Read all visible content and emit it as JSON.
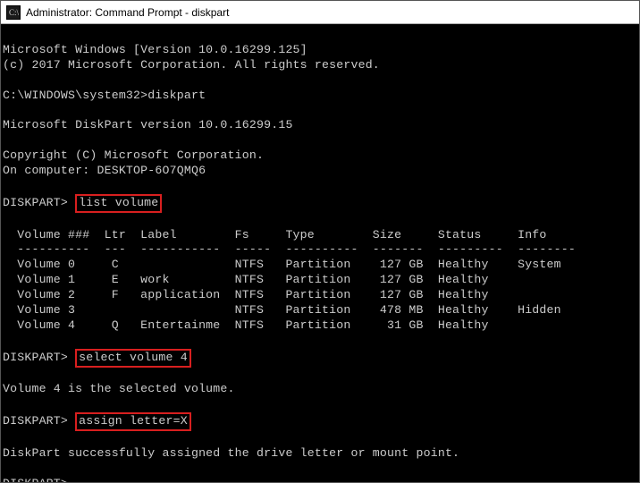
{
  "window": {
    "title": "Administrator: Command Prompt - diskpart"
  },
  "lines": {
    "win_ver": "Microsoft Windows [Version 10.0.16299.125]",
    "copyright1": "(c) 2017 Microsoft Corporation. All rights reserved.",
    "prompt1_path": "C:\\WINDOWS\\system32>",
    "prompt1_cmd": "diskpart",
    "dp_ver": "Microsoft DiskPart version 10.0.16299.15",
    "dp_copy": "Copyright (C) Microsoft Corporation.",
    "dp_computer": "On computer: DESKTOP-6O7QMQ6",
    "dp_prompt": "DISKPART>",
    "cmd_list": "list volume",
    "header": "  Volume ###  Ltr  Label        Fs     Type        Size     Status     Info",
    "divider": "  ----------  ---  -----------  -----  ----------  -------  ---------  --------",
    "row0": "  Volume 0     C                NTFS   Partition    127 GB  Healthy    System",
    "row1": "  Volume 1     E   work         NTFS   Partition    127 GB  Healthy",
    "row2": "  Volume 2     F   application  NTFS   Partition    127 GB  Healthy",
    "row3": "  Volume 3                      NTFS   Partition    478 MB  Healthy    Hidden",
    "row4": "  Volume 4     Q   Entertainme  NTFS   Partition     31 GB  Healthy",
    "cmd_select": "select volume 4",
    "selected_msg": "Volume 4 is the selected volume.",
    "cmd_assign": "assign letter=X",
    "assign_msg": "DiskPart successfully assigned the drive letter or mount point."
  }
}
